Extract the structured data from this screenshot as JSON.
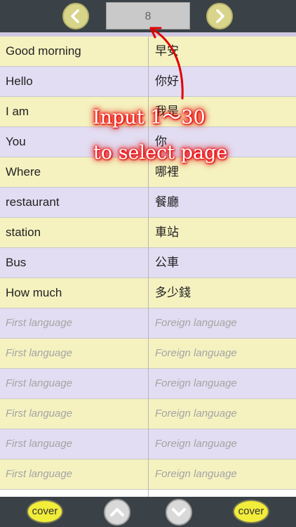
{
  "toolbar": {
    "page_value": "8",
    "prev_icon": "chevron-left-icon",
    "next_icon": "chevron-right-icon",
    "accent": "#d8d48a"
  },
  "rows": [
    {
      "first": "Good morning",
      "foreign": "早安",
      "placeholder": false
    },
    {
      "first": "Hello",
      "foreign": "你好",
      "placeholder": false
    },
    {
      "first": "I am",
      "foreign": "我是",
      "placeholder": false
    },
    {
      "first": "You",
      "foreign": "你",
      "placeholder": false
    },
    {
      "first": "Where",
      "foreign": "哪裡",
      "placeholder": false
    },
    {
      "first": "restaurant",
      "foreign": "餐廳",
      "placeholder": false
    },
    {
      "first": "station",
      "foreign": "車站",
      "placeholder": false
    },
    {
      "first": "Bus",
      "foreign": "公車",
      "placeholder": false
    },
    {
      "first": "How much",
      "foreign": "多少錢",
      "placeholder": false
    },
    {
      "first": "First language",
      "foreign": "Foreign language",
      "placeholder": true
    },
    {
      "first": "First language",
      "foreign": "Foreign language",
      "placeholder": true
    },
    {
      "first": "First language",
      "foreign": "Foreign language",
      "placeholder": true
    },
    {
      "first": "First language",
      "foreign": "Foreign language",
      "placeholder": true
    },
    {
      "first": "First language",
      "foreign": "Foreign language",
      "placeholder": true
    },
    {
      "first": "First language",
      "foreign": "Foreign language",
      "placeholder": true
    }
  ],
  "bottom": {
    "cover_left": "cover",
    "cover_right": "cover",
    "up_icon": "chevron-up-icon",
    "down_icon": "chevron-down-icon"
  },
  "overlay": {
    "line1": "Input 1～30",
    "line2": "to select page",
    "color": "#e00000"
  }
}
